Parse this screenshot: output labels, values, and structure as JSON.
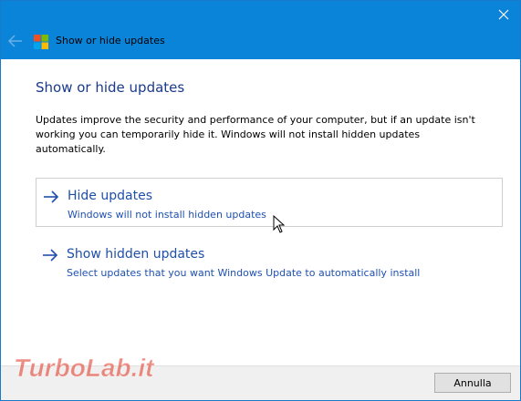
{
  "window": {
    "title": "Show or hide updates",
    "accent_color": "#0a84d8"
  },
  "main": {
    "heading": "Show or hide updates",
    "description": "Updates improve the security and performance of your computer, but if an update isn't working you can temporarily hide it. Windows will not install hidden updates automatically.",
    "options": [
      {
        "title": "Hide updates",
        "subtitle": "Windows will not install hidden updates",
        "icon": "arrow-right-icon"
      },
      {
        "title": "Show hidden updates",
        "subtitle": "Select updates that you want Windows Update to automatically install",
        "icon": "arrow-right-icon"
      }
    ]
  },
  "footer": {
    "cancel_label": "Annulla"
  },
  "watermark": {
    "text": "TurboLab.it"
  }
}
